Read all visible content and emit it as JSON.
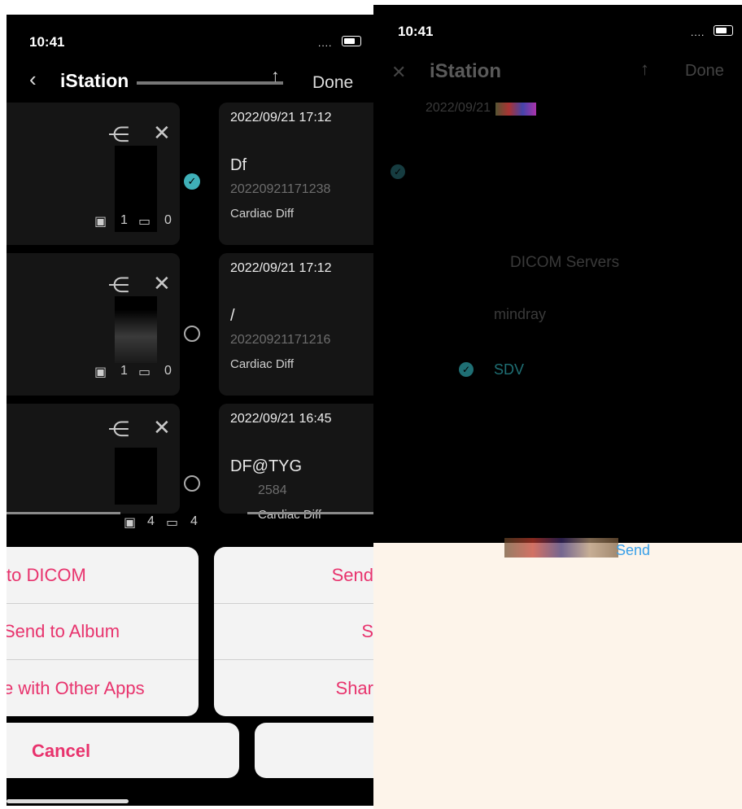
{
  "left": {
    "status": {
      "time": "10:41",
      "signal": "...."
    },
    "nav": {
      "back": "‹",
      "title": "iStation",
      "share": "↑",
      "done": "Done"
    },
    "records": [
      {
        "date": "2022/09/21 17:12",
        "name": "Df",
        "id": "20220921171238",
        "type": "Cardiac Diff",
        "photos": "1",
        "videos": "0",
        "selected": true
      },
      {
        "date": "2022/09/21 17:12",
        "name": "/",
        "id": "20220921171216",
        "type": "Cardiac Diff",
        "photos": "1",
        "videos": "0",
        "selected": false
      },
      {
        "date": "2022/09/21 16:45",
        "name": "DF@TYG",
        "id": "2584",
        "type": "Cardiac Diff",
        "photos": "4",
        "videos": "4",
        "selected": false
      }
    ],
    "sheet": {
      "items": [
        "to DICOM",
        "Send to Album",
        "e with Other Apps"
      ],
      "items_right": [
        "Send",
        "S",
        "Shar"
      ],
      "cancel": "Cancel"
    }
  },
  "right": {
    "status": {
      "time": "10:41",
      "signal": "...."
    },
    "nav": {
      "title": "iStation",
      "share": "↑",
      "done": "Done"
    },
    "record_date": "2022/09/21",
    "dialog": {
      "title": "DICOM Servers",
      "servers": [
        {
          "name": "mindray",
          "selected": false
        },
        {
          "name": "SDV",
          "selected": true
        }
      ],
      "send": "Send"
    }
  },
  "colors": {
    "accent": "#e8336d",
    "check": "#3fb0b8",
    "cream": "#fdf4ea"
  }
}
